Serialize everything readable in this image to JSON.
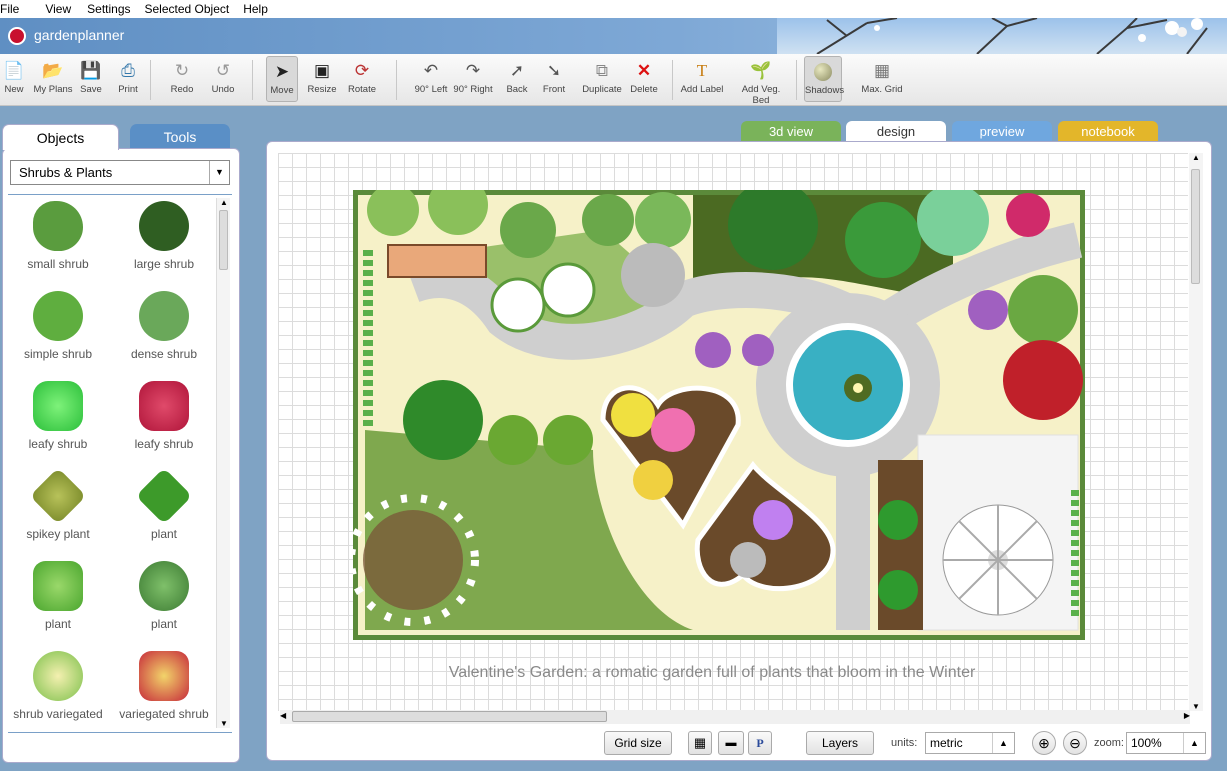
{
  "menu": [
    "File",
    "View",
    "Settings",
    "Selected Object",
    "Help"
  ],
  "app": {
    "name": "gardenplanner"
  },
  "toolbar": {
    "groups": [
      [
        {
          "label": "New",
          "icon": "new-file-icon"
        },
        {
          "label": "My Plans",
          "icon": "folder-open-icon"
        },
        {
          "label": "Save",
          "icon": "floppy-disk-icon"
        },
        {
          "label": "Print",
          "icon": "printer-icon"
        }
      ],
      [
        {
          "label": "Redo",
          "icon": "redo-icon"
        },
        {
          "label": "Undo",
          "icon": "undo-icon"
        }
      ],
      [
        {
          "label": "Move",
          "icon": "cursor-arrow-icon"
        },
        {
          "label": "Resize",
          "icon": "resize-icon"
        },
        {
          "label": "Rotate",
          "icon": "rotate-icon"
        }
      ],
      [
        {
          "label": "90° Left",
          "icon": "rotate-left-icon"
        },
        {
          "label": "90° Right",
          "icon": "rotate-right-icon"
        },
        {
          "label": "Back",
          "icon": "send-back-icon"
        },
        {
          "label": "Front",
          "icon": "bring-front-icon"
        },
        {
          "label": "Duplicate",
          "icon": "duplicate-icon"
        },
        {
          "label": "Delete",
          "icon": "delete-x-icon"
        }
      ],
      [
        {
          "label": "Add Label",
          "icon": "text-label-icon"
        },
        {
          "label": "Add Veg. Bed",
          "icon": "vegetable-bed-icon"
        }
      ],
      [
        {
          "label": "Shadows",
          "icon": "shadow-sphere-icon"
        },
        {
          "label": "Max. Grid",
          "icon": "max-grid-icon"
        }
      ]
    ],
    "active": "Move"
  },
  "left_panel": {
    "tabs": [
      "Objects",
      "Tools"
    ],
    "active_tab": "Objects",
    "category": "Shrubs & Plants",
    "items": [
      {
        "label": "small shrub",
        "color": "#5a9c3e"
      },
      {
        "label": "large shrub",
        "color": "#2f5e22"
      },
      {
        "label": "simple shrub",
        "color": "#5fae3f"
      },
      {
        "label": "dense shrub",
        "color": "#6aa85a"
      },
      {
        "label": "leafy shrub",
        "color": "#2bbf3a"
      },
      {
        "label": "leafy shrub",
        "color": "#b0153a"
      },
      {
        "label": "spikey plant",
        "color": "#7a8a2a"
      },
      {
        "label": "plant",
        "color": "#3d9a2a"
      },
      {
        "label": "plant",
        "color": "#4aa62e"
      },
      {
        "label": "plant",
        "color": "#3b7a32"
      },
      {
        "label": "shrub variegated",
        "color": "#7bbf4a"
      },
      {
        "label": "variegated shrub",
        "color": "#c62a3a"
      }
    ]
  },
  "view_tabs": [
    {
      "label": "3d view",
      "color": "#7ab35a"
    },
    {
      "label": "design",
      "color": "#ffffff"
    },
    {
      "label": "preview",
      "color": "#6fa7df"
    },
    {
      "label": "notebook",
      "color": "#e3b62a"
    }
  ],
  "active_view": "design",
  "caption": "Valentine's Garden: a romatic garden full of plants that bloom in the Winter",
  "bottom": {
    "grid_size": "Grid size",
    "layers": "Layers",
    "units_label": "units:",
    "units_value": "metric",
    "zoom_label": "zoom:",
    "zoom_value": "100%"
  }
}
